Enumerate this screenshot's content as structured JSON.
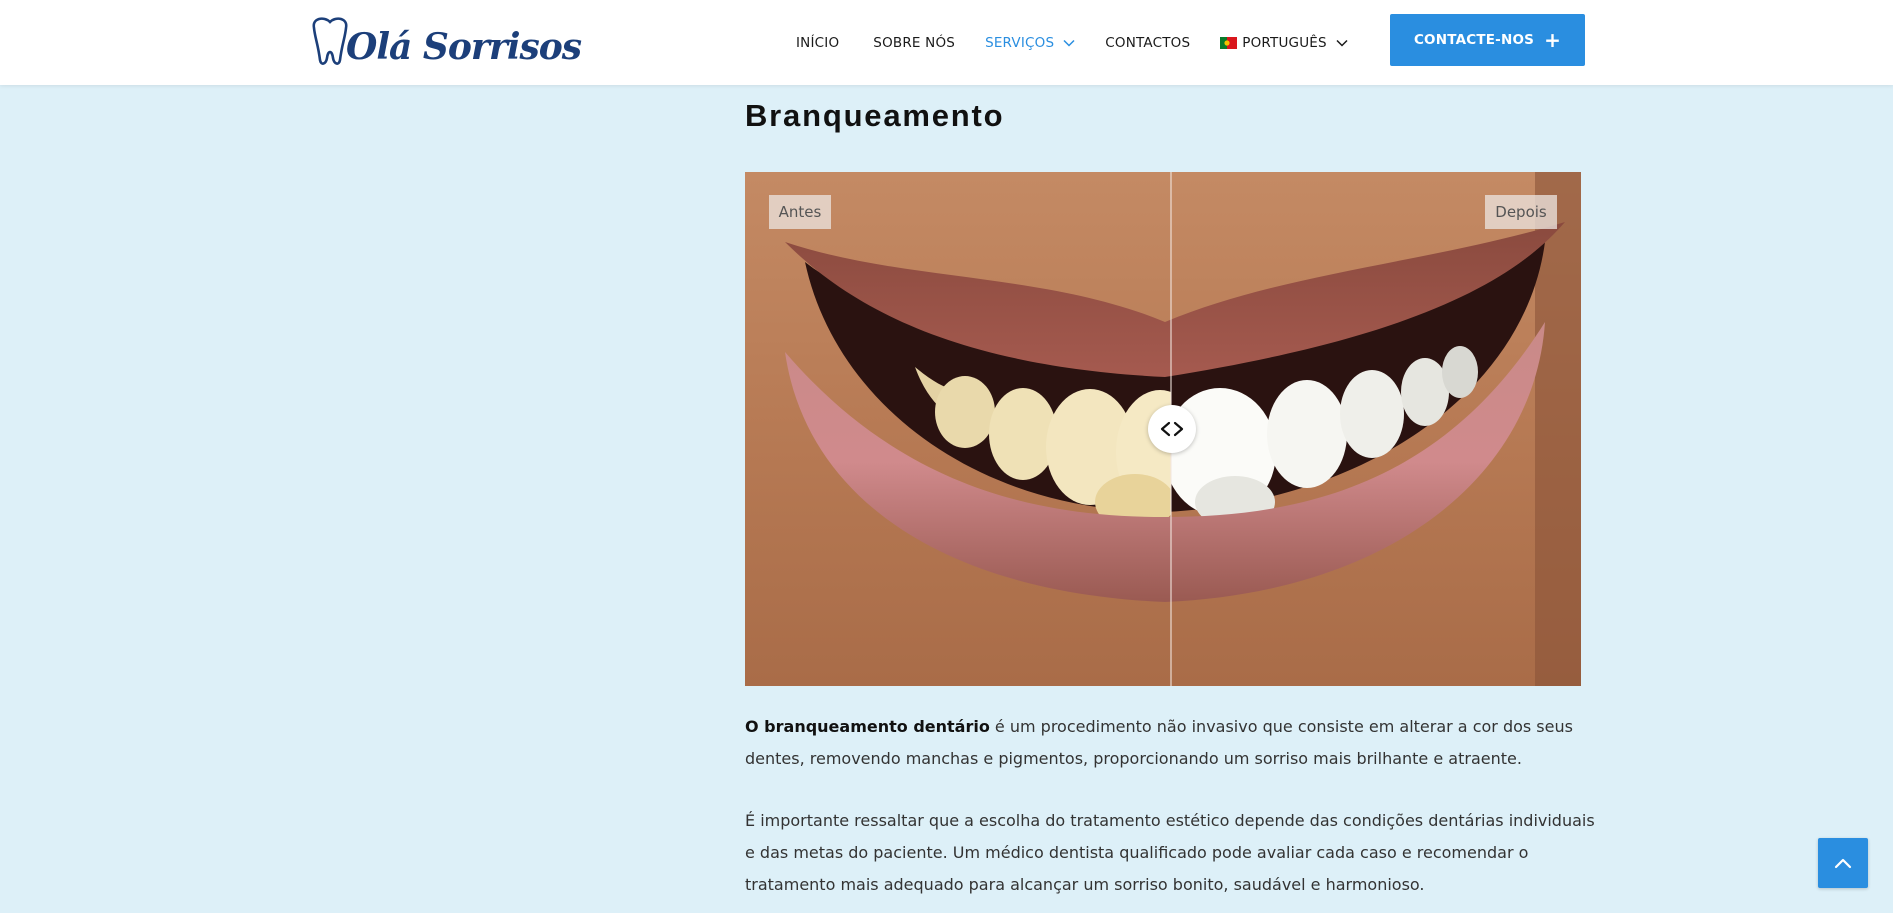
{
  "header": {
    "logo_text": "Olá Sorrisos",
    "nav": [
      {
        "label": "INÍCIO"
      },
      {
        "label": "SOBRE NÓS"
      },
      {
        "label": "SERVIÇOS"
      },
      {
        "label": "CONTACTOS"
      },
      {
        "label": "PORTUGUÊS"
      }
    ],
    "cta_label": "CONTACTE-NOS",
    "cta_plus": "+"
  },
  "main": {
    "title": "Branqueamento",
    "compare": {
      "before_label": "Antes",
      "after_label": "Depois",
      "slider_position_fraction": 0.51
    },
    "p1_bold": "O branqueamento dentário",
    "p1_rest": " é um procedimento não invasivo que consiste em alterar a cor dos seus dentes, removendo manchas e pigmentos, proporcionando um sorriso mais brilhante e atraente.",
    "p2": "É importante ressaltar que a escolha do tratamento estético depende das condições dentárias individuais e das metas do paciente. Um médico dentista qualificado pode avaliar cada caso e recomendar o tratamento mais adequado para alcançar um sorriso bonito, saudável e harmonioso."
  },
  "colors": {
    "accent": "#2a8ee0",
    "background": "#ddf0f8",
    "logo": "#1c3f7a"
  },
  "icons": {
    "dropdown": "chevron-down-icon",
    "handle": "arrows-left-right-icon",
    "back_to_top": "chevron-up-icon",
    "language_flag": "portugal-flag-icon"
  }
}
